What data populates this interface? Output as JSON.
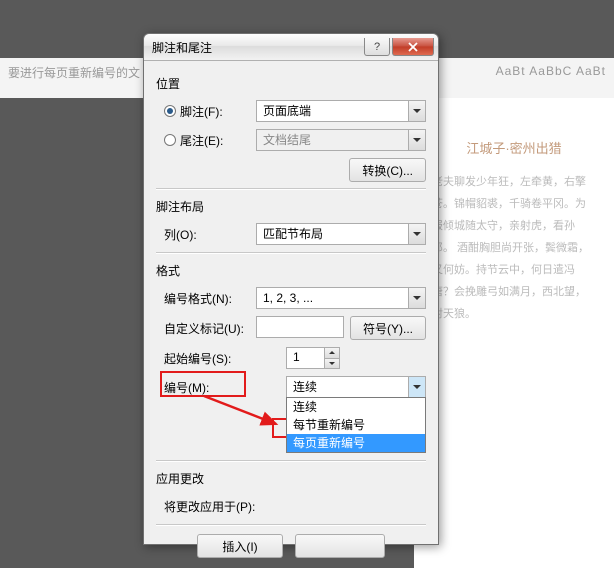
{
  "background": {
    "top_text": "要进行每页重新编号的文",
    "ribbon_right": "AaBt AaBbC AaBt",
    "doc_title": "江城子·密州出猎",
    "doc_body": "老夫聊发少年狂，左牵黄，右擎苍。锦帽貂裘，千骑卷平冈。为报倾城随太守，亲射虎，看孙郎。\n酒酣胸胆尚开张，鬓微霜，又何妨。持节云中，何日遣冯唐？会挽雕弓如满月，西北望，射天狼。"
  },
  "dialog": {
    "title": "脚注和尾注",
    "help_label": "?",
    "sections": {
      "position": "位置",
      "footnote_layout": "脚注布局",
      "format": "格式",
      "apply_changes": "应用更改"
    },
    "labels": {
      "footnote": "脚注(F):",
      "endnote": "尾注(E):",
      "columns": "列(O):",
      "number_format": "编号格式(N):",
      "custom_mark": "自定义标记(U):",
      "start_at": "起始编号(S):",
      "numbering": "编号(M):",
      "apply_to": "将更改应用于(P):"
    },
    "values": {
      "footnote_loc": "页面底端",
      "endnote_loc": "文档结尾",
      "columns_val": "匹配节布局",
      "number_format_val": "1, 2, 3, ...",
      "custom_mark_val": "",
      "start_at_val": "1",
      "numbering_val": "连续",
      "apply_to_val": ""
    },
    "dropdown": {
      "options": [
        "连续",
        "每节重新编号",
        "每页重新编号"
      ],
      "selected_index": 2
    },
    "buttons": {
      "convert": "转换(C)...",
      "symbol": "符号(Y)...",
      "insert": "插入(I)",
      "cancel": ""
    }
  }
}
